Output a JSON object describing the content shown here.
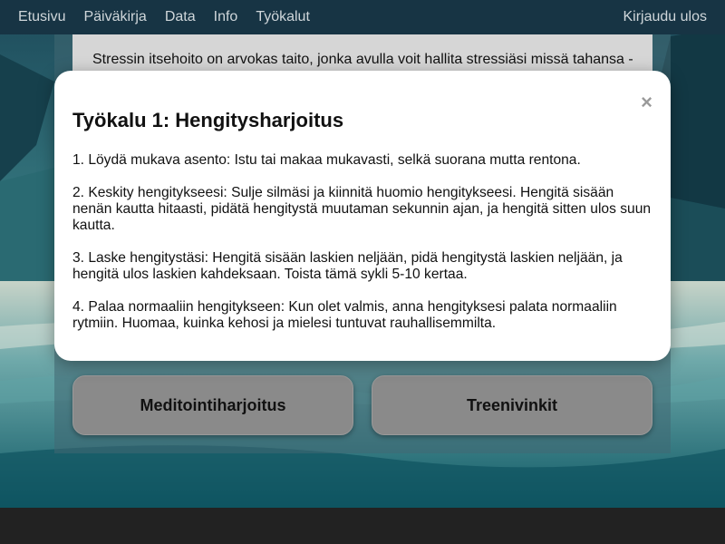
{
  "nav": {
    "items": [
      "Etusivu",
      "Päiväkirja",
      "Data",
      "Info",
      "Työkalut"
    ],
    "logout": "Kirjaudu ulos"
  },
  "intro": {
    "text": "Stressin itsehoito on arvokas taito, jonka avulla voit hallita stressiäsi missä tahansa -"
  },
  "modal": {
    "title": "Työkalu 1: Hengitysharjoitus",
    "close_icon": "×",
    "steps": [
      "1. Löydä mukava asento: Istu tai makaa mukavasti, selkä suorana mutta rentona.",
      "2. Keskity hengitykseesi: Sulje silmäsi ja kiinnitä huomio hengitykseesi. Hengitä sisään nenän kautta hitaasti, pidätä hengitystä muutaman sekunnin ajan, ja hengitä sitten ulos suun kautta.",
      "3. Laske hengitystäsi: Hengitä sisään laskien neljään, pidä hengitystä laskien neljään, ja hengitä ulos laskien kahdeksaan. Toista tämä sykli 5-10 kertaa.",
      "4. Palaa normaaliin hengitykseen: Kun olet valmis, anna hengityksesi palata normaaliin rytmiin. Huomaa, kuinka kehosi ja mielesi tuntuvat rauhallisemmilta."
    ]
  },
  "tools": {
    "meditation_label": "Meditointiharjoitus",
    "training_label": "Treenivinkit"
  },
  "colors": {
    "navbar": "#173444",
    "button": "#8a8a8a",
    "modal": "#ffffff"
  }
}
